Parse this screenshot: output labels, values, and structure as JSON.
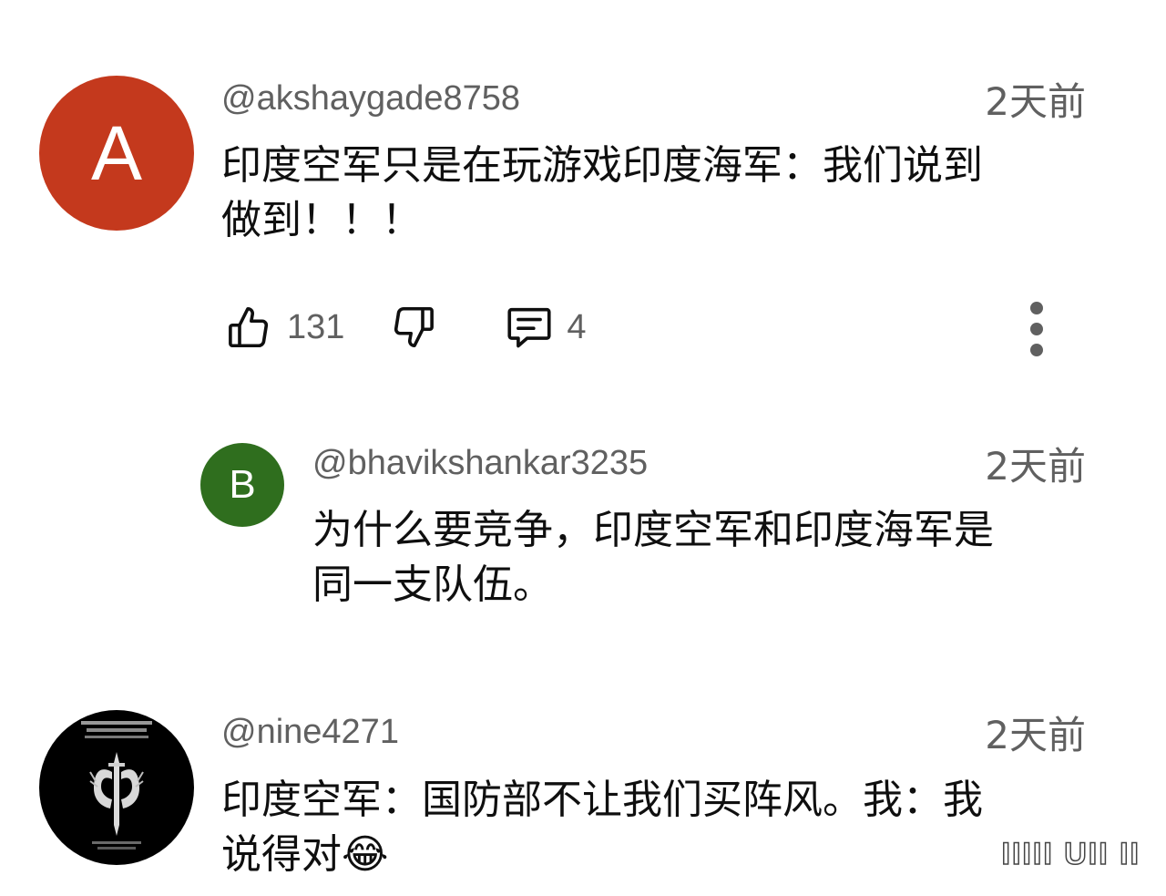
{
  "comments": [
    {
      "avatar_letter": "A",
      "avatar_color": "#c4391d",
      "handle": "@akshaygade8758",
      "time": "2天前",
      "text_line1": "印度空军只是在玩游戏印度海军：我们说到",
      "text_line2": "做到！！！",
      "likes": "131",
      "reply_count": "4"
    },
    {
      "avatar_letter": "B",
      "avatar_color": "#2f6e1e",
      "handle": "@bhavikshankar3235",
      "time": "2天前",
      "text_line1": "为什么要竞争，印度空军和印度海军是",
      "text_line2": "同一支队伍。"
    },
    {
      "avatar_icon": "dagger-wings-emblem-icon",
      "avatar_color": "#000000",
      "handle": "@nine4271",
      "time": "2天前",
      "text_line1": "印度空军：国防部不让我们买阵风。我：我",
      "text_line2": "说得对",
      "emoji": "😂"
    }
  ],
  "icons": {
    "like": "thumb-up-icon",
    "dislike": "thumb-down-icon",
    "reply": "comment-icon",
    "more": "more-vertical-icon"
  }
}
